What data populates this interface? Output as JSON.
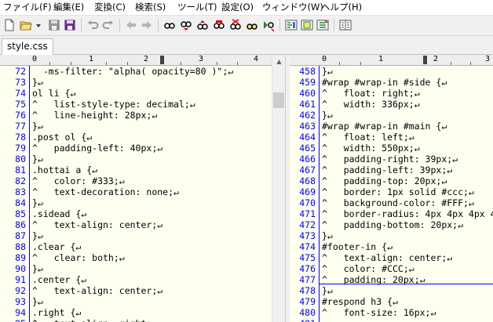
{
  "menu": [
    "ファイル(F)",
    "編集(E)",
    "変換(C)",
    "検索(S)",
    "ツール(T)",
    "設定(O)",
    "ウィンドウ(W)",
    "ヘルプ(H)"
  ],
  "toolbar_icons": [
    "new-file-icon",
    "open-folder-icon",
    "dropdown-arrow-icon",
    "save-icon",
    "save-all-icon",
    "undo-icon",
    "redo-icon",
    "back-icon",
    "forward-icon",
    "find-icon",
    "find-next-icon",
    "find-prev-icon",
    "replace-icon",
    "clear-highlight-icon",
    "find-files-icon",
    "grep-icon",
    "outline-icon",
    "bookmark-icon",
    "tag-jump-icon",
    "compare-icon"
  ],
  "tab": {
    "label": "style.css"
  },
  "left": {
    "ruler": [
      "0",
      "1",
      "2",
      "3",
      "4"
    ],
    "lines": [
      {
        "n": "72",
        "t": "  -ms-filter: \"alpha( opacity=80 )\";↵"
      },
      {
        "n": "73",
        "t": "}↵"
      },
      {
        "n": "74",
        "t": "ol li {↵"
      },
      {
        "n": "75",
        "t": "^   list-style-type: decimal;↵"
      },
      {
        "n": "76",
        "t": "^   line-height: 28px;↵"
      },
      {
        "n": "77",
        "t": "}↵"
      },
      {
        "n": "78",
        "t": ".post ol {↵"
      },
      {
        "n": "79",
        "t": "^   padding-left: 40px;↵"
      },
      {
        "n": "80",
        "t": "}↵"
      },
      {
        "n": "81",
        "t": ".hottai a {↵"
      },
      {
        "n": "82",
        "t": "^   color: #333;↵"
      },
      {
        "n": "83",
        "t": "^   text-decoration: none;↵"
      },
      {
        "n": "84",
        "t": "}↵"
      },
      {
        "n": "85",
        "t": ".sidead {↵"
      },
      {
        "n": "86",
        "t": "^   text-align: center;↵"
      },
      {
        "n": "87",
        "t": "}↵"
      },
      {
        "n": "88",
        "t": ".clear {↵"
      },
      {
        "n": "89",
        "t": "^   clear: both;↵"
      },
      {
        "n": "90",
        "t": "}↵"
      },
      {
        "n": "91",
        "t": ".center {↵"
      },
      {
        "n": "92",
        "t": "^   text-align: center;↵"
      },
      {
        "n": "93",
        "t": "}↵"
      },
      {
        "n": "94",
        "t": ".right {↵"
      },
      {
        "n": "95",
        "t": "^   text-align: right;↵"
      }
    ]
  },
  "right": {
    "ruler": [
      "0",
      "1",
      "2",
      "3"
    ],
    "lines": [
      {
        "n": "458",
        "t": "}↵"
      },
      {
        "n": "459",
        "t": "#wrap #wrap-in #side {↵"
      },
      {
        "n": "460",
        "t": "^   float: right;↵"
      },
      {
        "n": "461",
        "t": "^   width: 336px;↵"
      },
      {
        "n": "462",
        "t": "}↵"
      },
      {
        "n": "463",
        "t": "#wrap #wrap-in #main {↵"
      },
      {
        "n": "464",
        "t": "^   float: left;↵"
      },
      {
        "n": "465",
        "t": "^   width: 550px;↵"
      },
      {
        "n": "466",
        "t": "^   padding-right: 39px;↵"
      },
      {
        "n": "467",
        "t": "^   padding-left: 39px;↵"
      },
      {
        "n": "468",
        "t": "^   padding-top: 20px;↵"
      },
      {
        "n": "469",
        "t": "^   border: 1px solid #ccc;↵"
      },
      {
        "n": "470",
        "t": "^   background-color: #FFF;↵"
      },
      {
        "n": "471",
        "t": "^   border-radius: 4px 4px 4px 4"
      },
      {
        "n": "472",
        "t": "^   padding-bottom: 20px;↵"
      },
      {
        "n": "473",
        "t": "}↵"
      },
      {
        "n": "474",
        "t": "#footer-in {↵"
      },
      {
        "n": "475",
        "t": "^   text-align: center;↵"
      },
      {
        "n": "476",
        "t": "^   color: #CCC;↵"
      },
      {
        "n": "477",
        "t": "^   padding: 20px;↵"
      },
      {
        "n": "478",
        "t": "}↵"
      },
      {
        "n": "479",
        "t": "#respond h3 {↵"
      },
      {
        "n": "480",
        "t": "^   font-size: 16px;↵"
      },
      {
        "n": "481",
        "t": ""
      }
    ]
  },
  "colors": {
    "editor_bg": "#fffff0",
    "line_number": "#0000ff",
    "text": "#000000"
  }
}
